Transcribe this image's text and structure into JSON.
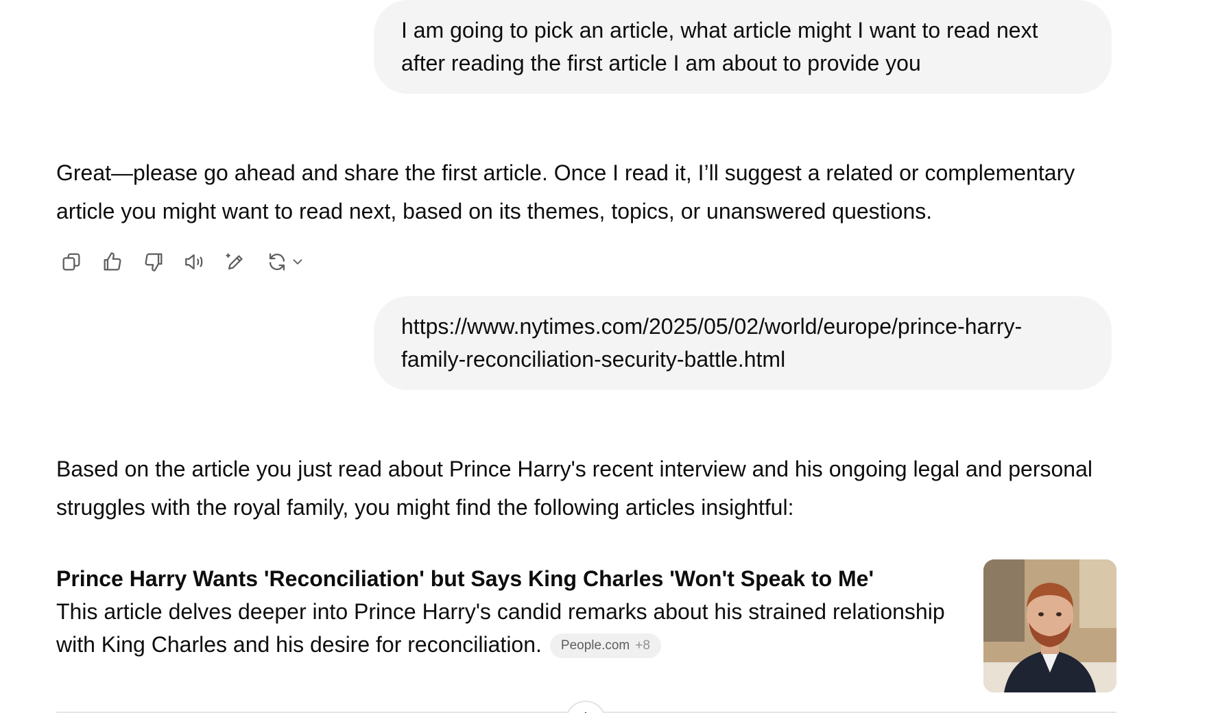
{
  "messages": {
    "user_1": "I am going to pick an article, what article might I want to read next after reading the first article I am about to provide you",
    "assistant_1": "Great—please go ahead and share the first article. Once I read it, I’ll suggest a related or complementary article you might want to read next, based on its themes, topics, or unanswered questions.",
    "user_2": "https://www.nytimes.com/2025/05/02/world/europe/prince-harry-family-reconciliation-security-battle.html",
    "assistant_2": "Based on the article you just read about Prince Harry's recent interview and his ongoing legal and personal struggles with the royal family, you might find the following articles insightful:"
  },
  "actions": {
    "icons": [
      "copy-icon",
      "thumbs-up-icon",
      "thumbs-down-icon",
      "read-aloud-icon",
      "edit-icon",
      "regenerate-icon",
      "chevron-down-icon"
    ]
  },
  "article": {
    "title": "Prince Harry Wants 'Reconciliation' but Says King Charles 'Won't Speak to Me'",
    "description": "This article delves deeper into Prince Harry's candid remarks about his strained relationship with King Charles and his desire for reconciliation.",
    "source": "People.com",
    "source_count": "+8"
  },
  "colors": {
    "bubble_bg": "#f4f4f4",
    "text": "#0d0d0d",
    "pill_bg": "#f0f0f0",
    "icon": "#5d5d5d"
  }
}
